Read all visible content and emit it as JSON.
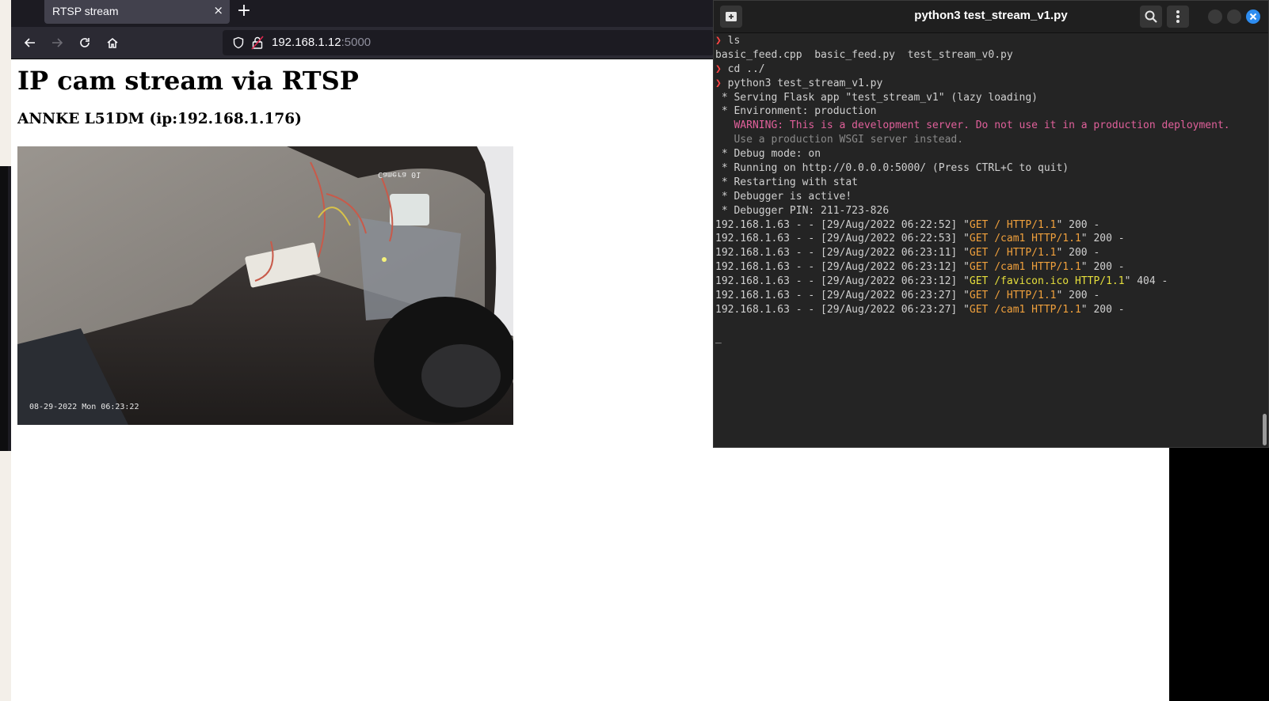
{
  "browser": {
    "tab": {
      "title": "RTSP stream",
      "close": "×"
    },
    "new_tab": "+",
    "url": {
      "host": "192.168.1.12",
      "port": ":5000"
    }
  },
  "page": {
    "title": "IP cam stream via RTSP",
    "subtitle": "ANNKE L51DM (ip:192.168.1.176)",
    "video": {
      "overlay_camera": "Camera 01",
      "overlay_timestamp": "08-29-2022 Mon 06:23:22"
    }
  },
  "terminal": {
    "title": "python3 test_stream_v1.py",
    "lines": [
      {
        "type": "cmd",
        "prompt": "❯",
        "text": " ls"
      },
      {
        "type": "plain",
        "text": "basic_feed.cpp  basic_feed.py  test_stream_v0.py"
      },
      {
        "type": "cmd",
        "prompt": "❯",
        "text": " cd ../"
      },
      {
        "type": "cmd",
        "prompt": "❯",
        "text": " python3 test_stream_v1.py"
      },
      {
        "type": "plain",
        "text": " * Serving Flask app \"test_stream_v1\" (lazy loading)"
      },
      {
        "type": "plain",
        "text": " * Environment: production"
      },
      {
        "type": "warn",
        "text": "   WARNING: This is a development server. Do not use it in a production deployment."
      },
      {
        "type": "dim",
        "text": "   Use a production WSGI server instead."
      },
      {
        "type": "plain",
        "text": " * Debug mode: on"
      },
      {
        "type": "plain",
        "text": " * Running on http://0.0.0.0:5000/ (Press CTRL+C to quit)"
      },
      {
        "type": "plain",
        "text": " * Restarting with stat"
      },
      {
        "type": "plain",
        "text": " * Debugger is active!"
      },
      {
        "type": "plain",
        "text": " * Debugger PIN: 211-723-826"
      },
      {
        "type": "log",
        "pre": "192.168.1.63 - - [29/Aug/2022 06:22:52] \"",
        "req": "GET / HTTP/1.1",
        "post": "\" 200 -"
      },
      {
        "type": "log",
        "pre": "192.168.1.63 - - [29/Aug/2022 06:22:53] \"",
        "req": "GET /cam1 HTTP/1.1",
        "post": "\" 200 -"
      },
      {
        "type": "log",
        "pre": "192.168.1.63 - - [29/Aug/2022 06:23:11] \"",
        "req": "GET / HTTP/1.1",
        "post": "\" 200 -"
      },
      {
        "type": "log",
        "pre": "192.168.1.63 - - [29/Aug/2022 06:23:12] \"",
        "req": "GET /cam1 HTTP/1.1",
        "post": "\" 200 -"
      },
      {
        "type": "log404",
        "pre": "192.168.1.63 - - [29/Aug/2022 06:23:12] \"",
        "req": "GET /favicon.ico HTTP/1.1",
        "post": "\" 404 -"
      },
      {
        "type": "log",
        "pre": "192.168.1.63 - - [29/Aug/2022 06:23:27] \"",
        "req": "GET / HTTP/1.1",
        "post": "\" 200 -"
      },
      {
        "type": "log",
        "pre": "192.168.1.63 - - [29/Aug/2022 06:23:27] \"",
        "req": "GET /cam1 HTTP/1.1",
        "post": "\" 200 -"
      },
      {
        "type": "plain",
        "text": ""
      },
      {
        "type": "plain",
        "text": "_"
      }
    ]
  }
}
